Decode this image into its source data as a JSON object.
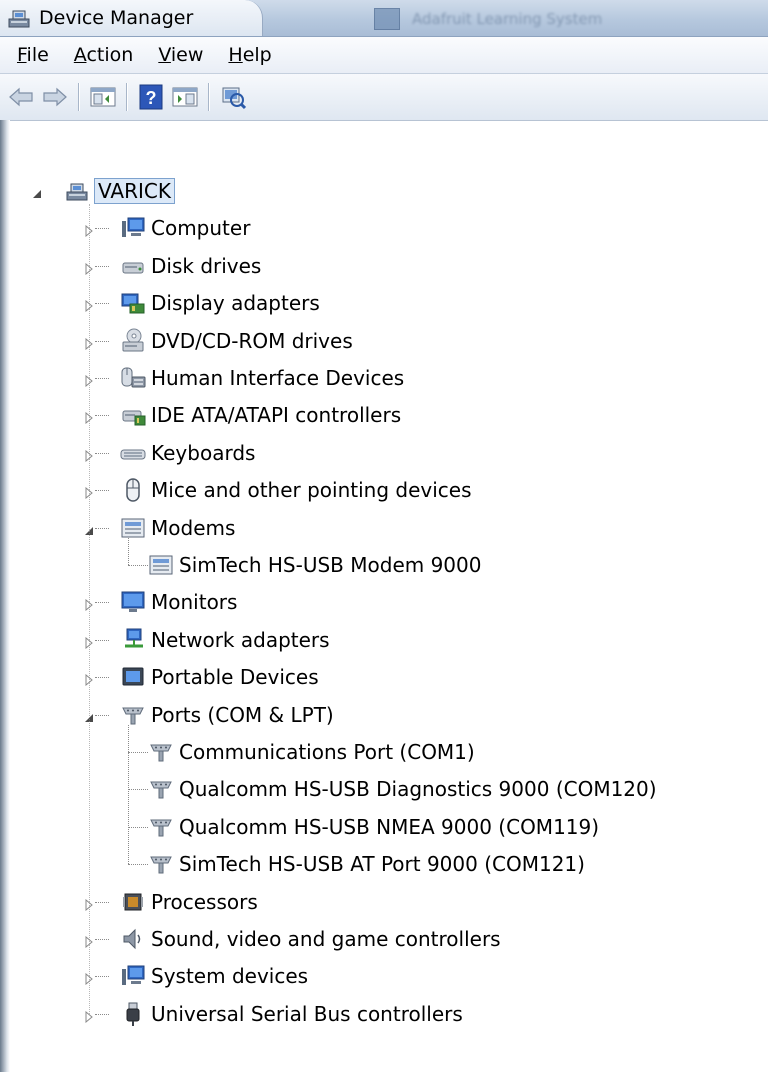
{
  "window": {
    "title": "Device Manager",
    "background_tab_title": "Adafruit Learning System"
  },
  "menu": {
    "file": {
      "u": "F",
      "rest": "ile"
    },
    "action": {
      "u": "A",
      "rest": "ction"
    },
    "view": {
      "u": "V",
      "rest": "iew"
    },
    "help": {
      "u": "H",
      "rest": "elp"
    }
  },
  "toolbar": [
    "back-icon",
    "forward-icon",
    "show-hide-console-tree-icon",
    "help-icon",
    "show-hide-action-pane-icon",
    "scan-hardware-icon"
  ],
  "tree": {
    "root": "VARICK",
    "categories": [
      {
        "label": "Computer",
        "icon": "computer-icon"
      },
      {
        "label": "Disk drives",
        "icon": "disk-drive-icon"
      },
      {
        "label": "Display adapters",
        "icon": "display-adapter-icon"
      },
      {
        "label": "DVD/CD-ROM drives",
        "icon": "dvd-drive-icon"
      },
      {
        "label": "Human Interface Devices",
        "icon": "hid-icon"
      },
      {
        "label": "IDE ATA/ATAPI controllers",
        "icon": "ide-controller-icon"
      },
      {
        "label": "Keyboards",
        "icon": "keyboard-icon"
      },
      {
        "label": "Mice and other pointing devices",
        "icon": "mouse-icon"
      },
      {
        "label": "Modems",
        "icon": "modem-icon",
        "expanded": true,
        "children": [
          "SimTech HS-USB Modem 9000"
        ]
      },
      {
        "label": "Monitors",
        "icon": "monitor-icon"
      },
      {
        "label": "Network adapters",
        "icon": "network-adapter-icon"
      },
      {
        "label": "Portable Devices",
        "icon": "portable-device-icon"
      },
      {
        "label": "Ports (COM & LPT)",
        "icon": "port-icon",
        "expanded": true,
        "children": [
          "Communications Port (COM1)",
          "Qualcomm HS-USB Diagnostics 9000 (COM120)",
          "Qualcomm HS-USB NMEA 9000 (COM119)",
          "SimTech HS-USB AT Port 9000 (COM121)"
        ]
      },
      {
        "label": "Processors",
        "icon": "processor-icon"
      },
      {
        "label": "Sound, video and game controllers",
        "icon": "sound-icon"
      },
      {
        "label": "System devices",
        "icon": "system-device-icon"
      },
      {
        "label": "Universal Serial Bus controllers",
        "icon": "usb-icon"
      }
    ]
  }
}
